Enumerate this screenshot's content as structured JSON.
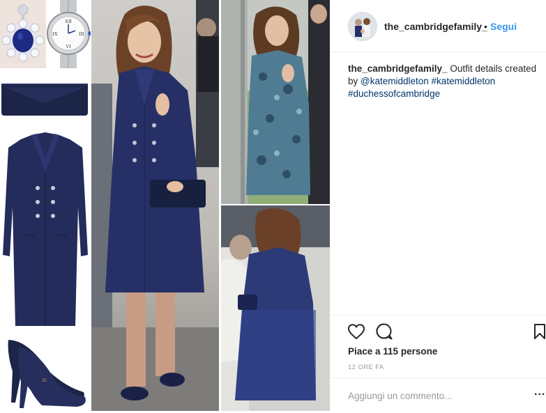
{
  "header": {
    "username": "the_cambridgefamily_",
    "separator": "•",
    "follow_label": "Segui"
  },
  "caption": {
    "username": "the_cambridgefamily_",
    "text": " Outfit details created by ",
    "mention": "@katemiddleton",
    "hashtag1": "#katemiddleton",
    "hashtag2": "#duchessofcambridge"
  },
  "stats": {
    "likes_label": "Piace a 115 persone",
    "time_label": "12 ORE FA"
  },
  "comment": {
    "placeholder": "Aggiungi un commento...",
    "more_label": "..."
  },
  "colors": {
    "accent": "#3897f0",
    "navy": "#1f2a55",
    "text": "#262626",
    "muted": "#999999"
  },
  "icons": {
    "like": "heart-icon",
    "comment": "comment-icon",
    "save": "bookmark-icon",
    "more": "ellipsis-icon"
  }
}
